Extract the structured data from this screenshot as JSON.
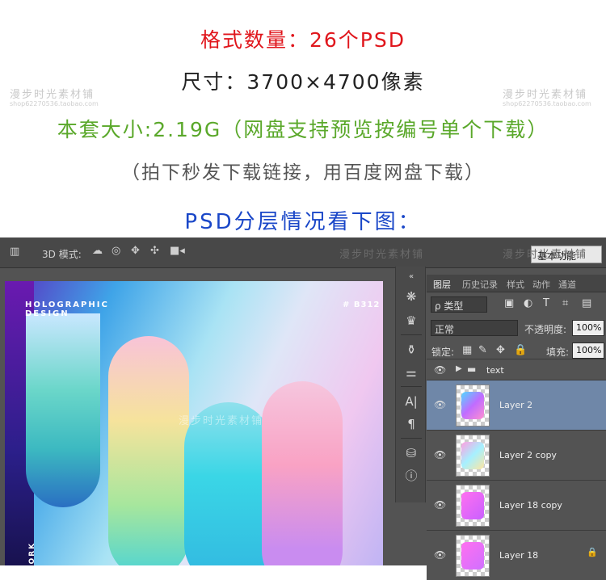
{
  "header": {
    "line1": "格式数量：26个PSD",
    "line2": "尺寸：3700×4700像素",
    "line3": "本套大小:2.19G（网盘支持预览按编号单个下载）",
    "line4": "（拍下秒发下载链接，用百度网盘下载）",
    "line5": "PSD分层情况看下图："
  },
  "watermark": {
    "text": "漫步时光素材铺",
    "small": "shop62270536.taobao.com"
  },
  "options_bar": {
    "mode_3d_label": "3D 模式:",
    "workspace_label": "基本功能"
  },
  "canvas": {
    "title": "HOLOGRAPHIC DESIGN",
    "code": "# B312",
    "vertical_text": "FIREWORK"
  },
  "layers_panel": {
    "tabs": [
      "图层",
      "历史记录",
      "样式",
      "动作",
      "通道"
    ],
    "filter_label": "ρ 类型",
    "blend_mode": "正常",
    "opacity_label": "不透明度:",
    "opacity_value": "100%",
    "lock_label": "锁定:",
    "fill_label": "填充:",
    "fill_value": "100%",
    "layers": [
      {
        "name": "text",
        "type": "group"
      },
      {
        "name": "Layer 2",
        "selected": true
      },
      {
        "name": "Layer 2 copy"
      },
      {
        "name": "Layer 18 copy"
      },
      {
        "name": "Layer 18",
        "locked": true
      }
    ]
  },
  "colors": {
    "line1": "#e0161c",
    "line3": "#5aa82a",
    "line5": "#1a47c8",
    "selected_layer": "#6f87a8"
  }
}
